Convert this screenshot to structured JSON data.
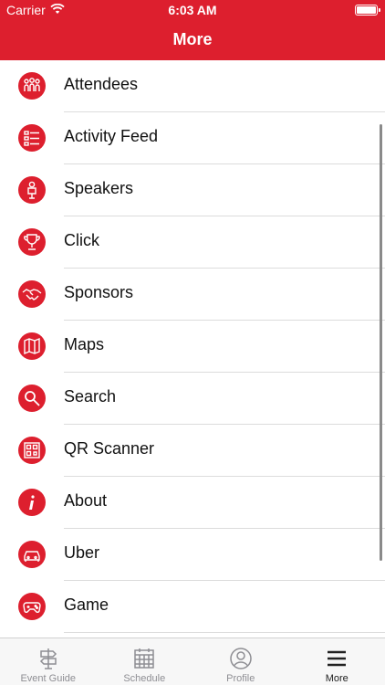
{
  "status": {
    "carrier": "Carrier",
    "time": "6:03 AM"
  },
  "header": {
    "title": "More"
  },
  "menu": [
    {
      "label": "Attendees",
      "icon": "attendees-icon"
    },
    {
      "label": "Activity Feed",
      "icon": "activity-feed-icon"
    },
    {
      "label": "Speakers",
      "icon": "speaker-icon"
    },
    {
      "label": "Click",
      "icon": "trophy-icon"
    },
    {
      "label": "Sponsors",
      "icon": "handshake-icon"
    },
    {
      "label": "Maps",
      "icon": "map-icon"
    },
    {
      "label": "Search",
      "icon": "search-icon"
    },
    {
      "label": "QR Scanner",
      "icon": "qr-code-icon"
    },
    {
      "label": "About",
      "icon": "info-icon"
    },
    {
      "label": "Uber",
      "icon": "car-icon"
    },
    {
      "label": "Game",
      "icon": "gamepad-icon"
    }
  ],
  "tabs": [
    {
      "label": "Event Guide",
      "icon": "signpost-icon"
    },
    {
      "label": "Schedule",
      "icon": "calendar-icon"
    },
    {
      "label": "Profile",
      "icon": "user-icon"
    },
    {
      "label": "More",
      "icon": "menu-icon"
    }
  ],
  "colors": {
    "brand": "#dd1f2e",
    "tab_inactive": "#8e8e93",
    "tab_active": "#222222"
  }
}
